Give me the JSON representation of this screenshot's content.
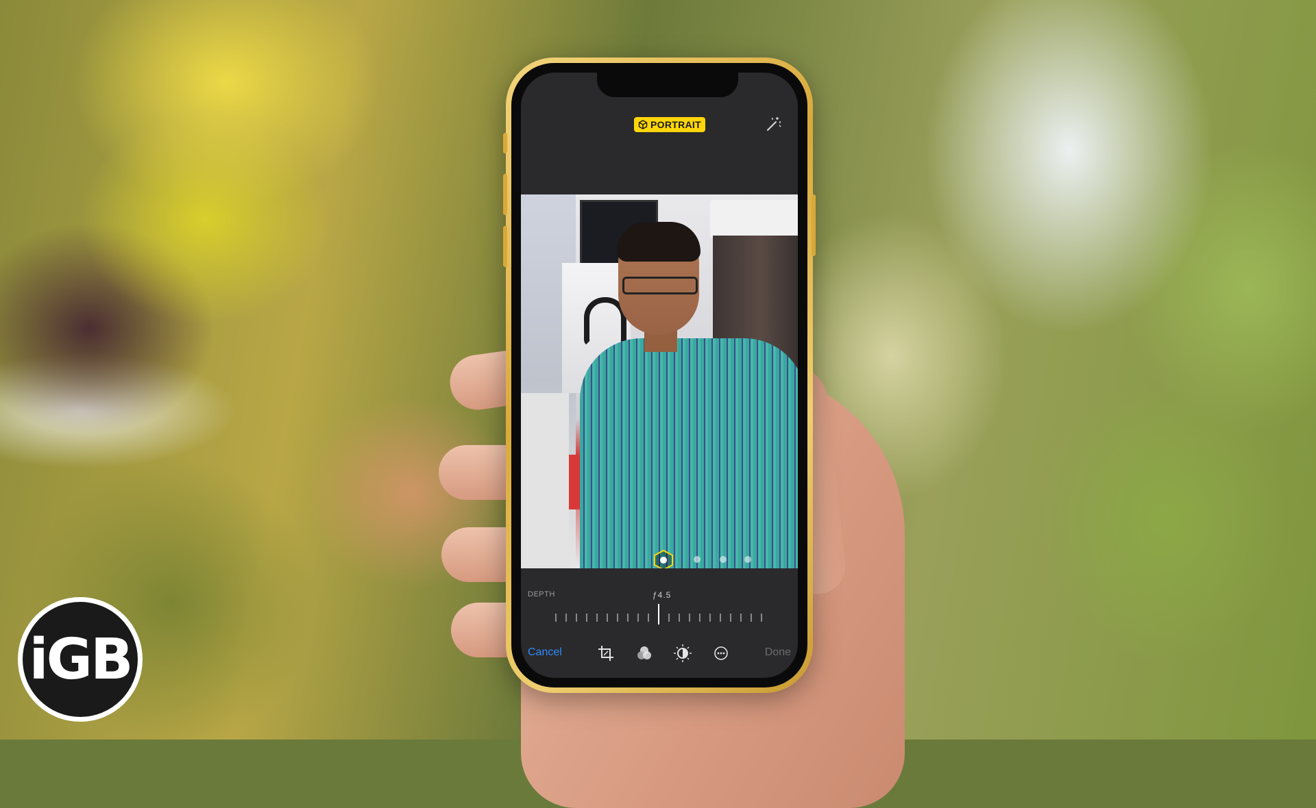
{
  "editor": {
    "mode_badge": "PORTRAIT",
    "depth_label": "DEPTH",
    "aperture_value": "ƒ4.5",
    "cancel_label": "Cancel",
    "done_label": "Done",
    "tools": [
      "crop-icon",
      "filters-icon",
      "adjust-icon",
      "more-icon"
    ]
  },
  "logo": {
    "text": "iGB"
  },
  "colors": {
    "badge": "#ffd60a",
    "cancel": "#2f8bff",
    "done_disabled": "#6c6c70",
    "phone_frame": "#e6c058"
  }
}
